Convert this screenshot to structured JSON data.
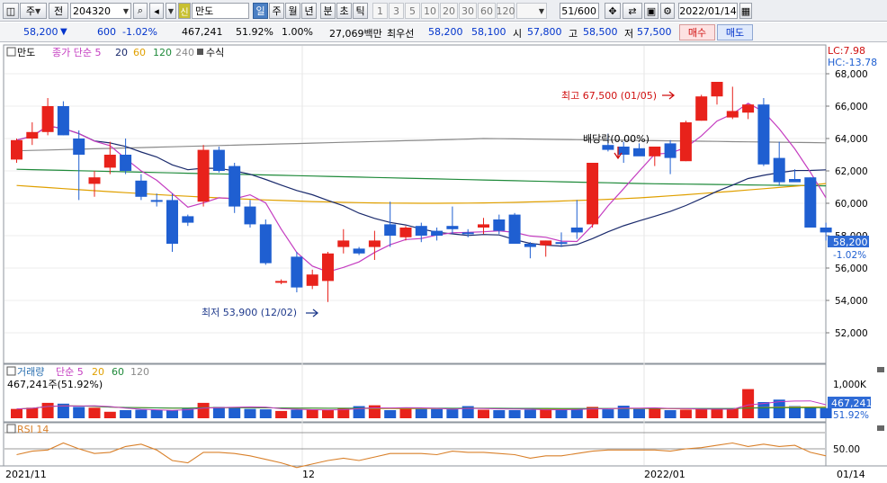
{
  "toolbar": {
    "period": "주",
    "market": "전",
    "code": "204320",
    "credit_badge": "신",
    "name": "만도",
    "tf_day": "일",
    "tf_week": "주",
    "tf_month": "월",
    "tf_year": "년",
    "tf_min": "분",
    "tf_tick": "초",
    "tf_tick2": "틱",
    "presets": [
      "1",
      "3",
      "5",
      "10",
      "20",
      "30",
      "60",
      "120"
    ],
    "count": "51/600",
    "date": "2022/01/14"
  },
  "quote": {
    "price": "58,200",
    "change": "600",
    "change_pct": "-1.02%",
    "volume": "467,241",
    "vol_ratio": "51.92%",
    "turnover_ratio": "1.00%",
    "amount": "27,069백만",
    "best_ask_label": "최우선",
    "best_ask": "58,200",
    "best_bid": "58,100",
    "open_label": "시",
    "open": "57,800",
    "high_label": "고",
    "high": "58,500",
    "low_label": "저",
    "low": "57,500",
    "buy_label": "매수",
    "sell_label": "매도"
  },
  "price_panel": {
    "legend_name": "만도",
    "legend_ma": "종가 단순 5",
    "ma_periods": [
      "20",
      "60",
      "120",
      "240"
    ],
    "formula": "수식",
    "lc_label": "LC:7.98",
    "hc_label": "HC:-13.78",
    "high_annot": "최고 67,500 (01/05)",
    "low_annot": "최저 53,900 (12/02)",
    "div_annot": "배당락(0.00%)",
    "axis_ticks": [
      "68,000",
      "66,000",
      "64,000",
      "62,000",
      "60,000",
      "58,000",
      "56,000",
      "54,000",
      "52,000"
    ],
    "last_price": "58,200",
    "last_pct": "-1.02%"
  },
  "volume_panel": {
    "legend_name": "거래량",
    "legend_ma": "단순 5",
    "ma_periods": [
      "20",
      "60",
      "120"
    ],
    "info": "467,241주(51.92%)",
    "axis_tick": "1,000K",
    "last_vol": "467,241",
    "last_pct": "51.92%"
  },
  "rsi_panel": {
    "legend": "RSI 14",
    "axis_tick": "50.00"
  },
  "x_axis": {
    "labels": [
      "2021/11",
      "12",
      "2022/01"
    ],
    "cursor_date": "01/14"
  },
  "colors": {
    "up": "#e8221b",
    "down": "#1f5fd1",
    "ma5": "#c43cc0",
    "ma20": "#1a2a6c",
    "ma60": "#e0a000",
    "ma120": "#1f8a3a",
    "ma240": "#8a8a8a",
    "rsi": "#d9802a"
  },
  "chart_data": {
    "type": "candlestick",
    "dates": [
      "11/01",
      "11/02",
      "11/03",
      "11/04",
      "11/05",
      "11/08",
      "11/09",
      "11/10",
      "11/11",
      "11/12",
      "11/15",
      "11/16",
      "11/17",
      "11/18",
      "11/19",
      "11/22",
      "11/23",
      "11/24",
      "11/25",
      "11/26",
      "11/29",
      "11/30",
      "12/01",
      "12/02",
      "12/03",
      "12/06",
      "12/07",
      "12/08",
      "12/09",
      "12/10",
      "12/13",
      "12/14",
      "12/15",
      "12/16",
      "12/17",
      "12/20",
      "12/21",
      "12/22",
      "12/23",
      "12/24",
      "12/27",
      "12/28",
      "12/29",
      "12/30",
      "01/03",
      "01/04",
      "01/05",
      "01/06",
      "01/07",
      "01/10",
      "01/11",
      "01/12",
      "01/13",
      "01/14"
    ],
    "ohlc": [
      [
        62700,
        64000,
        62500,
        63900
      ],
      [
        64000,
        65000,
        63600,
        64400
      ],
      [
        64400,
        66500,
        64200,
        66000
      ],
      [
        66000,
        66300,
        64200,
        64200
      ],
      [
        64000,
        64500,
        60200,
        63000
      ],
      [
        61200,
        62000,
        60400,
        61600
      ],
      [
        62200,
        63800,
        61800,
        63000
      ],
      [
        63000,
        64000,
        61800,
        62000
      ],
      [
        61400,
        61800,
        60200,
        60400
      ],
      [
        60200,
        60600,
        59800,
        60100
      ],
      [
        60200,
        60600,
        57000,
        57500
      ],
      [
        59200,
        59300,
        58600,
        58800
      ],
      [
        60100,
        63600,
        59800,
        63300
      ],
      [
        63300,
        63500,
        61900,
        62000
      ],
      [
        62300,
        62500,
        59400,
        59800
      ],
      [
        59800,
        60200,
        58500,
        58700
      ],
      [
        58700,
        59000,
        56200,
        56300
      ],
      [
        55100,
        55300,
        55000,
        55200
      ],
      [
        56700,
        57000,
        54500,
        54800
      ],
      [
        54900,
        55900,
        54700,
        55600
      ],
      [
        55200,
        57000,
        53900,
        56900
      ],
      [
        57300,
        58400,
        56900,
        57700
      ],
      [
        57200,
        57300,
        56800,
        56900
      ],
      [
        57300,
        58300,
        56500,
        57700
      ],
      [
        58700,
        60100,
        57300,
        58000
      ],
      [
        57900,
        58600,
        57700,
        58500
      ],
      [
        58600,
        58800,
        57600,
        58000
      ],
      [
        58300,
        58500,
        57700,
        58000
      ],
      [
        58600,
        59800,
        58100,
        58400
      ],
      [
        58200,
        58400,
        57900,
        58100
      ],
      [
        58500,
        59100,
        58100,
        58700
      ],
      [
        59000,
        59300,
        58100,
        58300
      ],
      [
        59300,
        59400,
        57900,
        57500
      ],
      [
        57500,
        57600,
        56600,
        57300
      ],
      [
        57400,
        57700,
        56700,
        57700
      ],
      [
        57600,
        58200,
        57300,
        57500
      ],
      [
        58500,
        60200,
        57800,
        58200
      ],
      [
        58700,
        62500,
        58500,
        62500
      ],
      [
        63600,
        64300,
        63200,
        63300
      ],
      [
        63500,
        63800,
        62500,
        63000
      ],
      [
        63400,
        63700,
        63000,
        62900
      ],
      [
        62900,
        63400,
        62300,
        63500
      ],
      [
        63700,
        63900,
        61800,
        62800
      ],
      [
        62600,
        65100,
        62600,
        65000
      ],
      [
        65100,
        66700,
        65100,
        66600
      ],
      [
        66600,
        66800,
        66100,
        67500
      ],
      [
        65300,
        67200,
        65200,
        65700
      ],
      [
        65600,
        66100,
        65200,
        66100
      ],
      [
        66100,
        66500,
        62300,
        62400
      ],
      [
        62800,
        63800,
        61100,
        61300
      ],
      [
        61500,
        62100,
        61400,
        61300
      ],
      [
        61600,
        61600,
        58500,
        58500
      ],
      [
        58500,
        58800,
        57700,
        58200
      ]
    ],
    "volume_k": [
      230,
      260,
      380,
      360,
      280,
      260,
      160,
      200,
      210,
      210,
      200,
      240,
      380,
      280,
      270,
      230,
      220,
      180,
      210,
      220,
      200,
      250,
      300,
      320,
      200,
      240,
      230,
      230,
      220,
      300,
      210,
      200,
      200,
      210,
      230,
      220,
      220,
      280,
      220,
      310,
      230,
      250,
      200,
      210,
      230,
      230,
      240,
      720,
      400,
      460,
      300,
      260,
      250,
      450
    ],
    "rsi": [
      45,
      48,
      49,
      55,
      50,
      46,
      47,
      52,
      54,
      49,
      40,
      38,
      47,
      47,
      46,
      44,
      41,
      38,
      34,
      37,
      40,
      42,
      40,
      43,
      46,
      46,
      46,
      45,
      48,
      47,
      47,
      46,
      45,
      42,
      44,
      44,
      46,
      48,
      49,
      49,
      49,
      49,
      48,
      50,
      51,
      53,
      55,
      52,
      54,
      52,
      53,
      47,
      44,
      43
    ],
    "series": [
      {
        "name": "5",
        "role": "ma5"
      },
      {
        "name": "20",
        "role": "ma20"
      },
      {
        "name": "60",
        "role": "ma60"
      },
      {
        "name": "120",
        "role": "ma120"
      },
      {
        "name": "240",
        "role": "ma240"
      }
    ],
    "ylim": [
      51000,
      69000
    ]
  }
}
